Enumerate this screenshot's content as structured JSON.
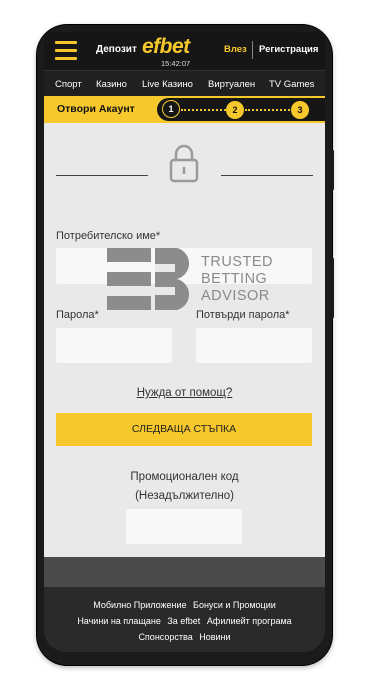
{
  "header": {
    "deposit_label": "Депозит",
    "logo": "efbet",
    "clock": "15:42:07",
    "login_label": "Влез",
    "register_label": "Регистрация"
  },
  "nav": {
    "items": [
      {
        "label": "Спорт"
      },
      {
        "label": "Казино"
      },
      {
        "label": "Live Казино"
      },
      {
        "label": "Виртуален"
      },
      {
        "label": "TV Games"
      }
    ]
  },
  "steps": {
    "title": "Отвори Акаунт",
    "items": [
      {
        "label": "1",
        "active": true
      },
      {
        "label": "2",
        "active": false
      },
      {
        "label": "3",
        "active": false
      }
    ]
  },
  "form": {
    "username_label": "Потребителско име*",
    "password_label": "Парола*",
    "confirm_password_label": "Потвърди парола*",
    "help_link": "Нужда от помощ?",
    "next_button": "СЛЕДВАЩА СТЪПКА",
    "promo_label_line1": "Промоционален код",
    "promo_label_line2": "(Незадължително)"
  },
  "watermark": {
    "line1": "TRUSTED",
    "line2": "BETTING",
    "line3": "ADVISOR"
  },
  "footer": {
    "row1": [
      "Мобилно Приложение",
      "Бонуси и Промоции"
    ],
    "row2": [
      "Начини на плащане",
      "За efbet",
      "Афилиейт програма"
    ],
    "row3": [
      "Спонсорства",
      "Новини"
    ]
  },
  "colors": {
    "accent": "#f7c82b",
    "header_bg": "#161616",
    "form_bg": "#e9e9e9",
    "footer_bg": "#2a2a2a"
  }
}
